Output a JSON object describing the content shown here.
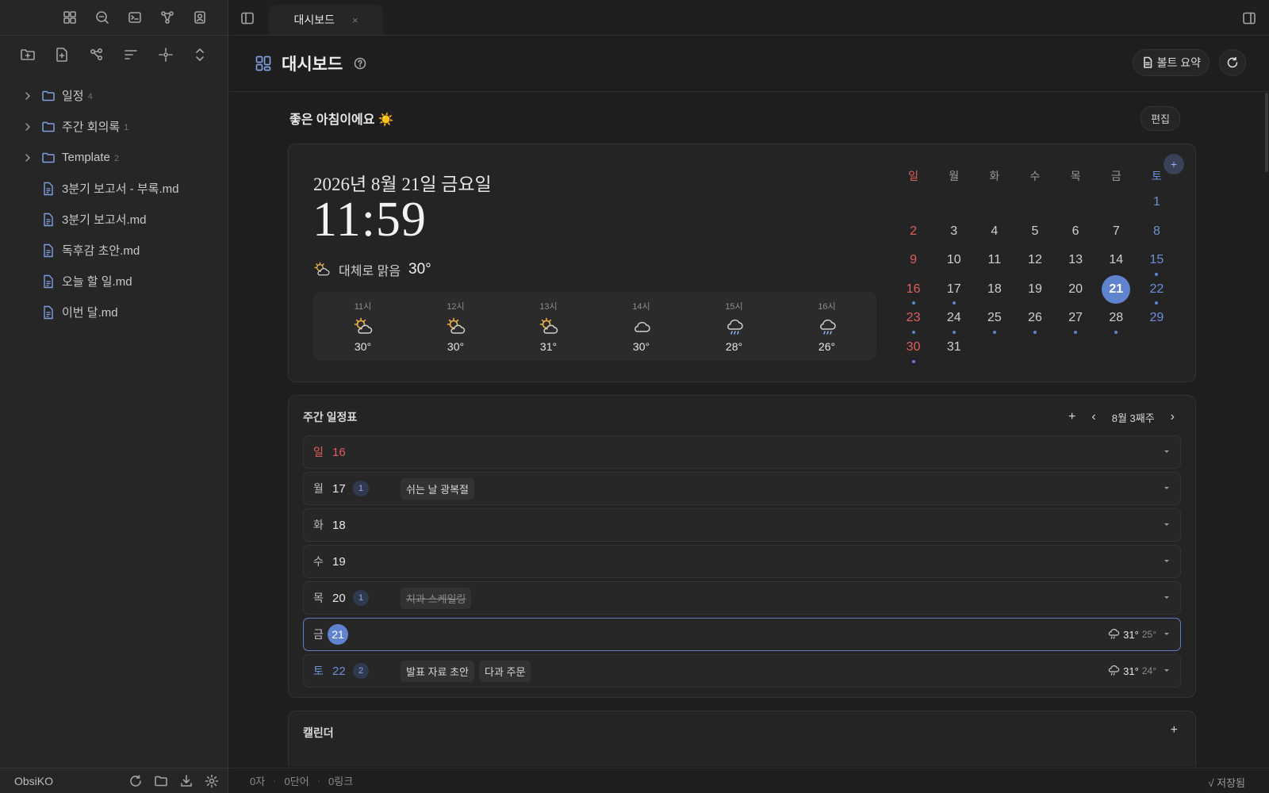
{
  "sidebar": {
    "tree": [
      {
        "type": "folder",
        "label": "일정",
        "count": "4"
      },
      {
        "type": "folder",
        "label": "주간 회의록",
        "count": "1"
      },
      {
        "type": "folder",
        "label": "Template",
        "count": "2"
      },
      {
        "type": "file",
        "label": "3분기 보고서 - 부록.md"
      },
      {
        "type": "file",
        "label": "3분기 보고서.md"
      },
      {
        "type": "file",
        "label": "독후감 초안.md"
      },
      {
        "type": "file",
        "label": "오늘 할 일.md"
      },
      {
        "type": "file",
        "label": "이번 달.md"
      }
    ],
    "vault_name": "ObsiKO"
  },
  "tab": {
    "label": "대시보드",
    "close": "×"
  },
  "view": {
    "title": "대시보드",
    "summary_label": "볼트 요약"
  },
  "dashboard": {
    "greeting": "좋은 아침이에요 ☀️",
    "edit_label": "편집",
    "date": "2026년 8월 21일 금요일",
    "time": "11:59",
    "weather": {
      "desc": "대체로 맑음",
      "temp": "30°"
    },
    "hourly": [
      {
        "label": "11시",
        "icon": "sun-cloud",
        "temp": "30°"
      },
      {
        "label": "12시",
        "icon": "sun-cloud",
        "temp": "30°"
      },
      {
        "label": "13시",
        "icon": "sun-cloud",
        "temp": "31°"
      },
      {
        "label": "14시",
        "icon": "cloud",
        "temp": "30°"
      },
      {
        "label": "15시",
        "icon": "rain-cloud",
        "temp": "28°"
      },
      {
        "label": "16시",
        "icon": "rain-cloud",
        "temp": "26°"
      }
    ],
    "mini_calendar": {
      "add": "+",
      "weekdays": [
        "일",
        "월",
        "화",
        "수",
        "목",
        "금",
        "토"
      ],
      "first_weekday": 6,
      "days_in_month": 31,
      "today": 21,
      "event_days": [
        15,
        16,
        17,
        22,
        23,
        24,
        25,
        26,
        27,
        28,
        30
      ]
    }
  },
  "weekly": {
    "title": "주간 일정표",
    "add": "+",
    "prev": "‹",
    "week_label": "8월 3째주",
    "next": "›",
    "days": [
      {
        "wd": "일",
        "num": "16",
        "kind": "sun",
        "badge": "",
        "events": [],
        "wx": null
      },
      {
        "wd": "월",
        "num": "17",
        "kind": "",
        "badge": "1",
        "events": [
          {
            "text": "쉬는 날 광복절",
            "done": false
          }
        ],
        "wx": null
      },
      {
        "wd": "화",
        "num": "18",
        "kind": "",
        "badge": "",
        "events": [],
        "wx": null
      },
      {
        "wd": "수",
        "num": "19",
        "kind": "",
        "badge": "",
        "events": [],
        "wx": null
      },
      {
        "wd": "목",
        "num": "20",
        "kind": "",
        "badge": "1",
        "events": [
          {
            "text": "치과 스케일링",
            "done": true
          }
        ],
        "wx": null
      },
      {
        "wd": "금",
        "num": "21",
        "kind": "today",
        "badge": "",
        "events": [],
        "wx": {
          "hi": "31°",
          "lo": "25°"
        }
      },
      {
        "wd": "토",
        "num": "22",
        "kind": "sat",
        "badge": "2",
        "events": [
          {
            "text": "발표 자료 초안",
            "done": false
          },
          {
            "text": "다과 주문",
            "done": false
          }
        ],
        "wx": {
          "hi": "31°",
          "lo": "24°"
        }
      }
    ]
  },
  "calendar_card": {
    "title": "캘린더",
    "add": "+"
  },
  "status": {
    "chars": "0자",
    "words": "0단어",
    "links": "0링크",
    "saved": "√ 저장됨"
  }
}
